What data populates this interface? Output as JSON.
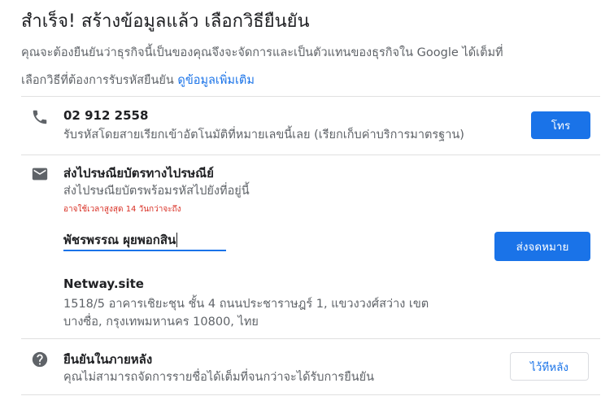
{
  "header": {
    "title": "สำเร็จ! สร้างข้อมูลแล้ว เลือกวิธียืนยัน",
    "intro_line1": "คุณจะต้องยืนยันว่าธุรกิจนี้เป็นของคุณจึงจะจัดการและเป็นตัวแทนของธุรกิจใน Google ได้เต็มที่",
    "intro_line2": "เลือกวิธีที่ต้องการรับรหัสยืนยัน",
    "learn_more": "ดูข้อมูลเพิ่มเติม"
  },
  "phone_option": {
    "icon": "phone-icon",
    "number": "02 912 2558",
    "description": "รับรหัสโดยสายเรียกเข้าอัตโนมัติที่หมายเลขนี้เลย (เรียกเก็บค่าบริการมาตรฐาน)",
    "button_label": "โทร"
  },
  "mail_option": {
    "icon": "mail-icon",
    "title": "ส่งไปรษณียบัตรทางไปรษณีย์",
    "description": "ส่งไปรษณียบัตรพร้อมรหัสไปยังที่อยู่นี้",
    "warning": "อาจใช้เวลาสูงสุด 14 วันกว่าจะถึง",
    "recipient_name": "พัชรพรรณ ผุยพอกสิน",
    "button_label": "ส่งจดหมาย",
    "business_name": "Netway.site",
    "address_line1": "1518/5 อาคารเชิยะชุน ชั้น 4 ถนนประชาราษฎร์ 1, แขวงวงศ์สว่าง เขต",
    "address_line2": "บางซื่อ, กรุงเทพมหานคร 10800, ไทย"
  },
  "later_option": {
    "icon": "help-icon",
    "title": "ยืนยันในภายหลัง",
    "description": "คุณไม่สามารถจัดการรายชื่อได้เต็มที่จนกว่าจะได้รับการยืนยัน",
    "button_label": "ไว้ทีหลัง"
  },
  "colors": {
    "accent": "#1a73e8",
    "warning": "#d93025",
    "secondary_text": "#5f6368"
  }
}
